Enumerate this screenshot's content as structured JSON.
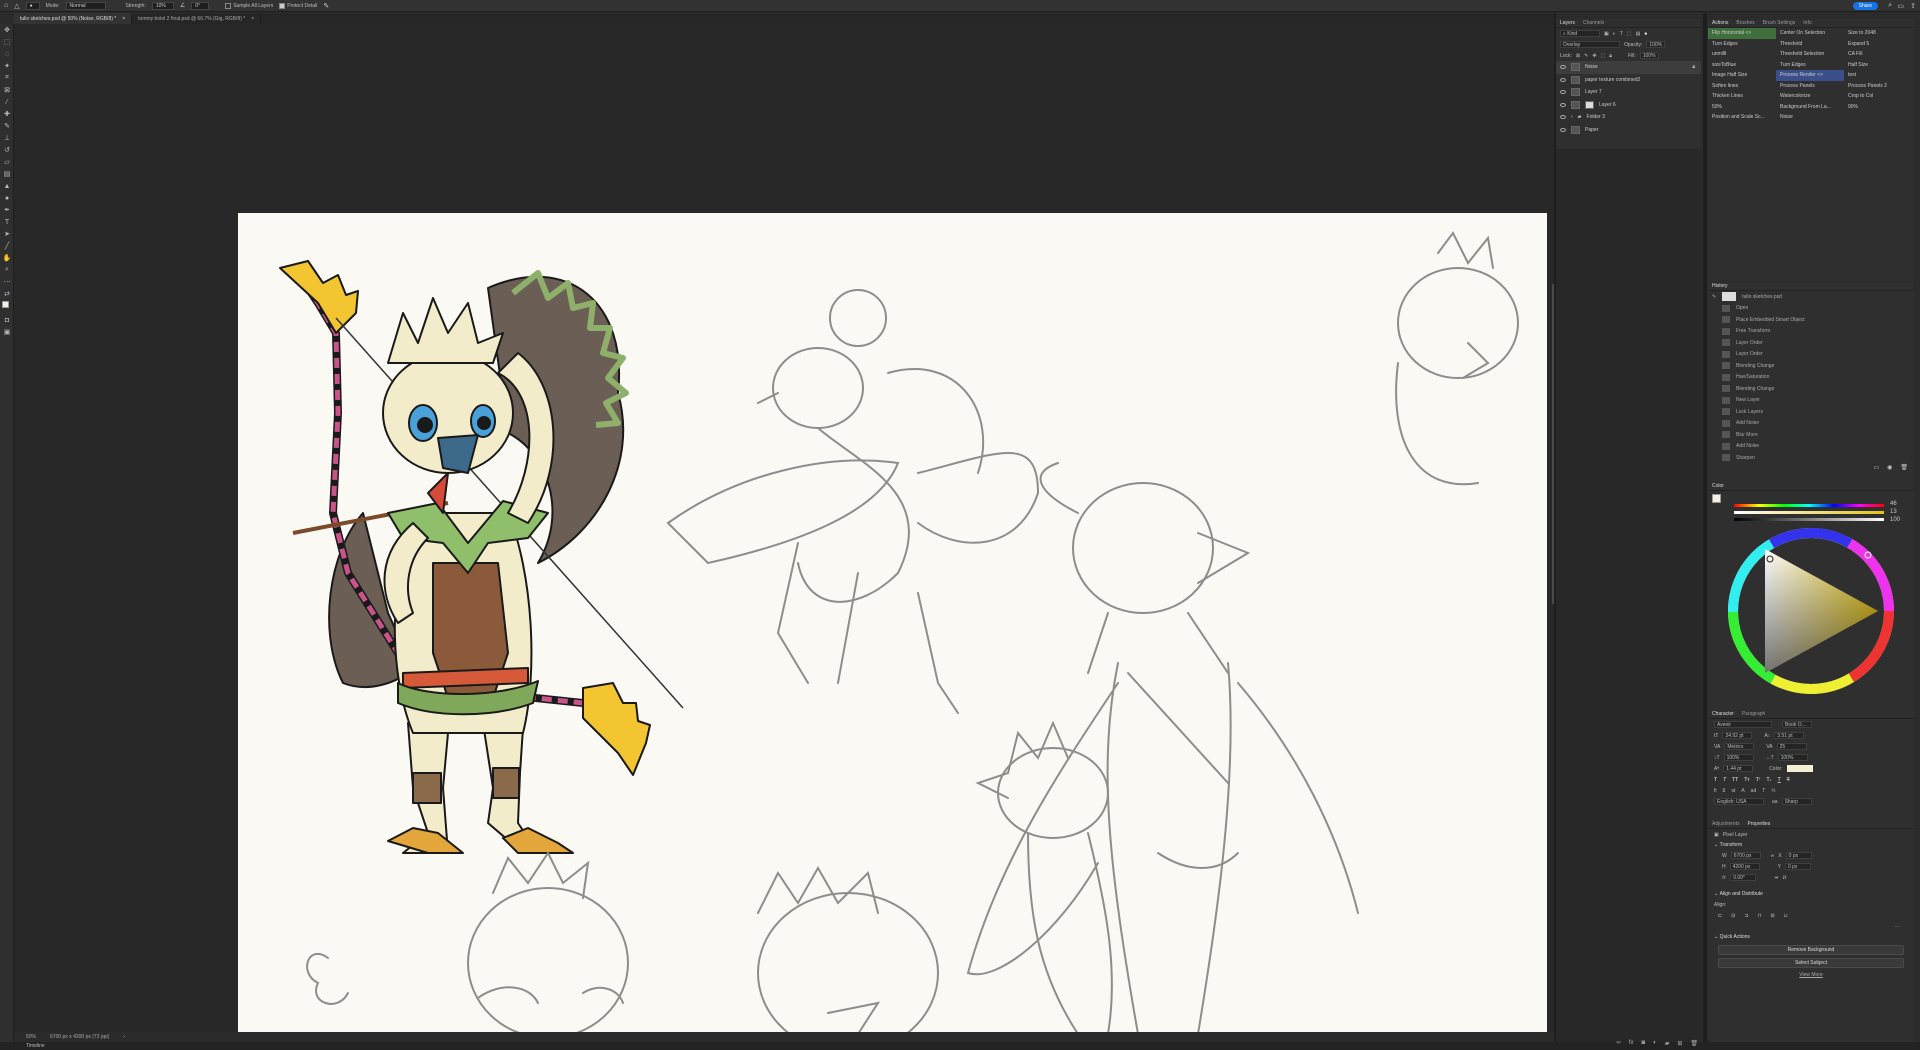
{
  "options_bar": {
    "mode_label": "Mode:",
    "mode_value": "Normal",
    "strength_label": "Strength:",
    "strength_value": "10%",
    "angle_value": "0°",
    "sample_all_layers": "Sample All Layers",
    "protect_detail": "Protect Detail",
    "share": "Share"
  },
  "tabs": [
    {
      "label": "tulio sketches.psd @ 50% (Noise, RGB/8) *",
      "active": true
    },
    {
      "label": "tommy botol 2 final.psd @ 66.7% (Gig, RGB/8) *",
      "active": false
    }
  ],
  "layers_panel": {
    "tabs": [
      "Layers",
      "Channels"
    ],
    "filter": "Kind",
    "blend_mode": "Overlay",
    "opacity_label": "Opacity:",
    "opacity_value": "100%",
    "lock_label": "Lock:",
    "fill_label": "Fill:",
    "fill_value": "100%",
    "layers": [
      {
        "name": "Noise",
        "selected": true
      },
      {
        "name": "paper texture combined2",
        "selected": false
      },
      {
        "name": "Layer 7",
        "selected": false
      },
      {
        "name": "Layer 6",
        "selected": false
      },
      {
        "name": "Folder 3",
        "selected": false
      },
      {
        "name": "Paper",
        "selected": false
      }
    ]
  },
  "actions_panel": {
    "tabs": [
      "Actions",
      "Brushes",
      "Brush Settings",
      "Info"
    ],
    "columns": [
      [
        "Flip Horizontal <>",
        "Turn Edges",
        "unmillt",
        "sizeToBlue",
        "Image Half Size",
        "Soften lines",
        "Thicken Lines",
        "50%",
        "Position and Scale Sc..."
      ],
      [
        "Center On Selection",
        "Threshold",
        "Threshold Selection",
        "Turn Edges",
        "Process Render <>",
        "Process Panels",
        "Watercolorize",
        "Background From La...",
        "Noise"
      ],
      [
        "Size to 2048",
        "Expand 5",
        "CA Fill",
        "Half Size",
        "test",
        "Process Panels 2",
        "Crop to Col",
        "90%"
      ]
    ]
  },
  "history_panel": {
    "title": "History",
    "snapshot": "tulio sketches.psd",
    "steps": [
      "Open",
      "Place Embedded Smart Object",
      "Free Transform",
      "Layer Order",
      "Layer Order",
      "Blending Change",
      "Hue/Saturation",
      "Blending Change",
      "New Layer",
      "Lock Layers",
      "Add Noise",
      "Blur More",
      "Add Noise",
      "Sharpen"
    ]
  },
  "color_panel": {
    "title": "Color",
    "slider_values": [
      "46",
      "13",
      "100"
    ],
    "hue_color": "#e3c41a"
  },
  "character_panel": {
    "tabs": [
      "Character",
      "Paragraph"
    ],
    "font_family": "Avenir",
    "font_style": "Book O...",
    "font_size": "24.92 pt",
    "leading": "3.51 pt",
    "kerning": "Metrics",
    "tracking": "25",
    "vscale": "100%",
    "hscale": "100%",
    "baseline": "1.44 pt",
    "color_label": "Color:",
    "language": "English: USA",
    "antialias": "Sharp"
  },
  "properties_panel": {
    "tabs": [
      "Adjustments",
      "Properties"
    ],
    "kind": "Pixel Layer",
    "transform_title": "Transform",
    "w_label": "W",
    "w_value": "6700 px",
    "h_label": "H",
    "h_value": "4200 px",
    "x_label": "X",
    "x_value": "0 px",
    "y_label": "Y",
    "y_value": "0 px",
    "angle_value": "0.00°",
    "align_title": "Align and Distribute",
    "align_label": "Align:",
    "quick_actions_title": "Quick Actions",
    "remove_bg": "Remove Background",
    "select_subject": "Select Subject",
    "view_more": "View More"
  },
  "status": {
    "zoom": "50%",
    "doc_size": "6700 px x 4200 px (72 ppi)"
  },
  "timeline": "Timeline"
}
